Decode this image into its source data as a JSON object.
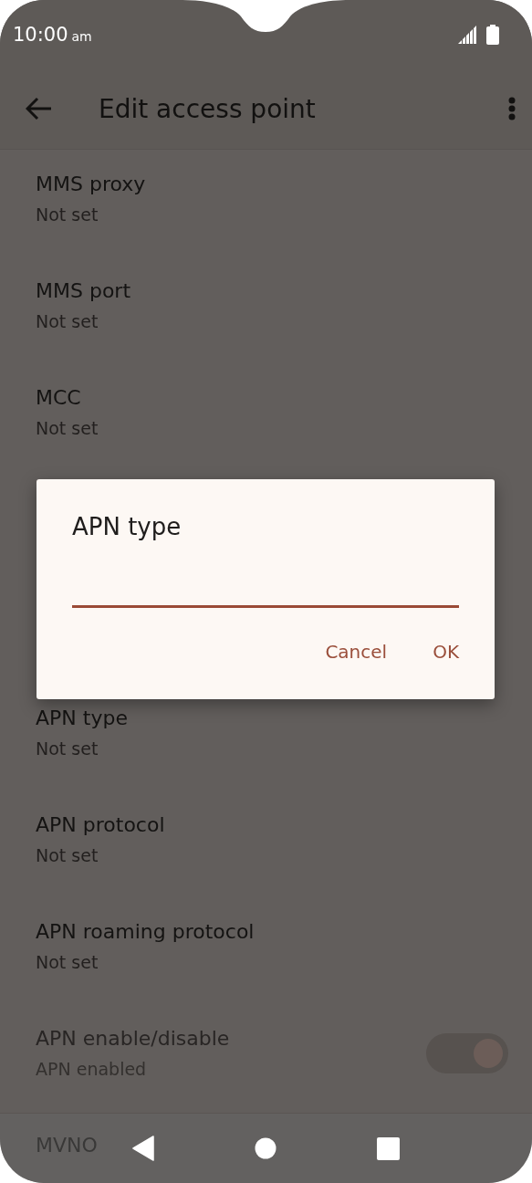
{
  "status_bar": {
    "time": "10:00",
    "meridiem": "am"
  },
  "toolbar": {
    "title": "Edit access point"
  },
  "settings_above": [
    {
      "title": "MMS proxy",
      "summary": "Not set",
      "disabled": false
    },
    {
      "title": "MMS port",
      "summary": "Not set",
      "disabled": false
    },
    {
      "title": "MCC",
      "summary": "Not set",
      "disabled": false
    }
  ],
  "settings_below": [
    {
      "title": "APN type",
      "summary": "Not set",
      "disabled": false,
      "kind": "text"
    },
    {
      "title": "APN protocol",
      "summary": "Not set",
      "disabled": false,
      "kind": "text"
    },
    {
      "title": "APN roaming protocol",
      "summary": "Not set",
      "disabled": false,
      "kind": "text"
    },
    {
      "title": "APN enable/disable",
      "summary": "APN enabled",
      "disabled": true,
      "kind": "switch",
      "on": true
    },
    {
      "title": "MVNO",
      "kind": "text"
    }
  ],
  "dialog": {
    "title": "APN type",
    "buttons": [
      "Cancel",
      "OK"
    ]
  }
}
